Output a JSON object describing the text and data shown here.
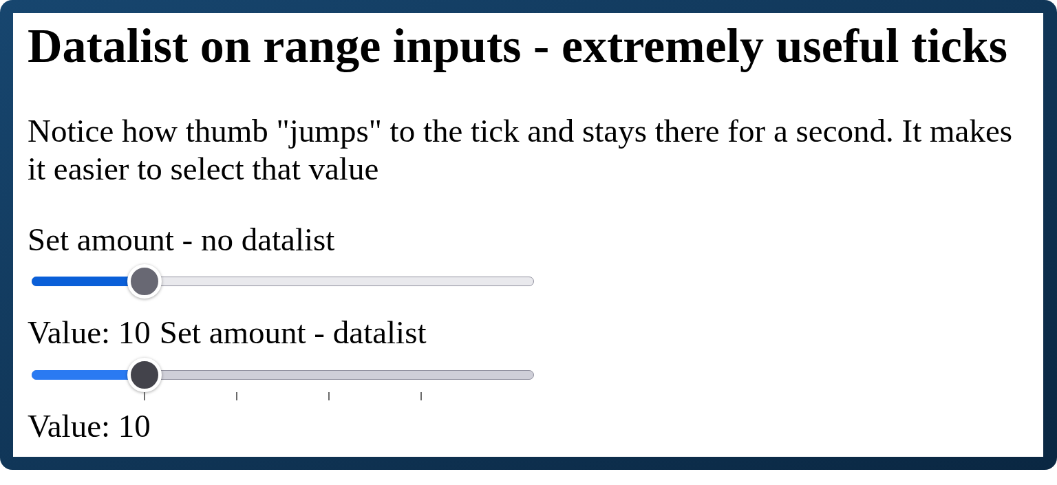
{
  "title": "Datalist on range inputs - extremely useful ticks",
  "description": "Notice how thumb \"jumps\" to the tick and stays there for a second. It makes it easier to select that value",
  "controls": [
    {
      "label": "Set amount - no datalist",
      "slider": {
        "kind": "plain",
        "level": 0.2,
        "active": false
      },
      "value": "Value: 10"
    },
    {
      "label": "Set amount - datalist",
      "slider": {
        "kind": "ticked",
        "level": 0.2,
        "active": true
      },
      "value": "Value: 10"
    }
  ]
}
